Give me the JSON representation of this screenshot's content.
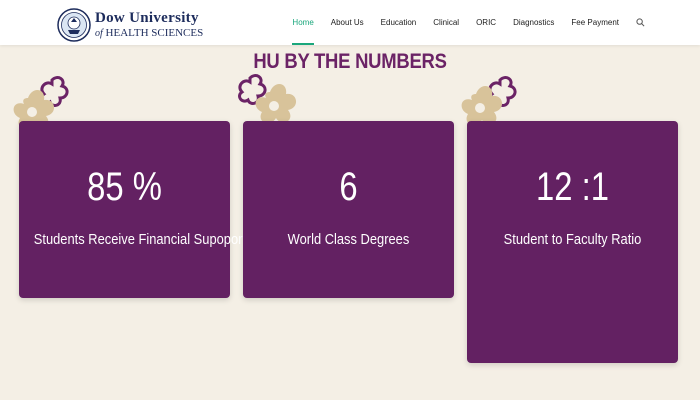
{
  "header": {
    "logo": {
      "line1": "Dow University",
      "line2_of": "of",
      "line2": "HEALTH SCIENCES"
    },
    "nav": [
      {
        "label": "Home",
        "active": true
      },
      {
        "label": "About Us",
        "active": false
      },
      {
        "label": "Education",
        "active": false
      },
      {
        "label": "Clinical",
        "active": false
      },
      {
        "label": "ORIC",
        "active": false
      },
      {
        "label": "Diagnostics",
        "active": false
      },
      {
        "label": "Fee Payment",
        "active": false
      }
    ],
    "search_icon": "search-icon",
    "accent_color": "#1aa77c"
  },
  "section": {
    "title": "HU BY THE NUMBERS",
    "title_color": "#6b2366"
  },
  "stats": [
    {
      "value": "85 %",
      "label": "Students Receive Financial Supoport"
    },
    {
      "value": "6",
      "label": "World Class Degrees"
    },
    {
      "value": "12 :1",
      "label": "Student to Faculty Ratio"
    }
  ],
  "colors": {
    "card": "#632162",
    "background": "#f4efe5",
    "flower_beige": "#d8c39a",
    "flower_purple": "#6b2366"
  }
}
